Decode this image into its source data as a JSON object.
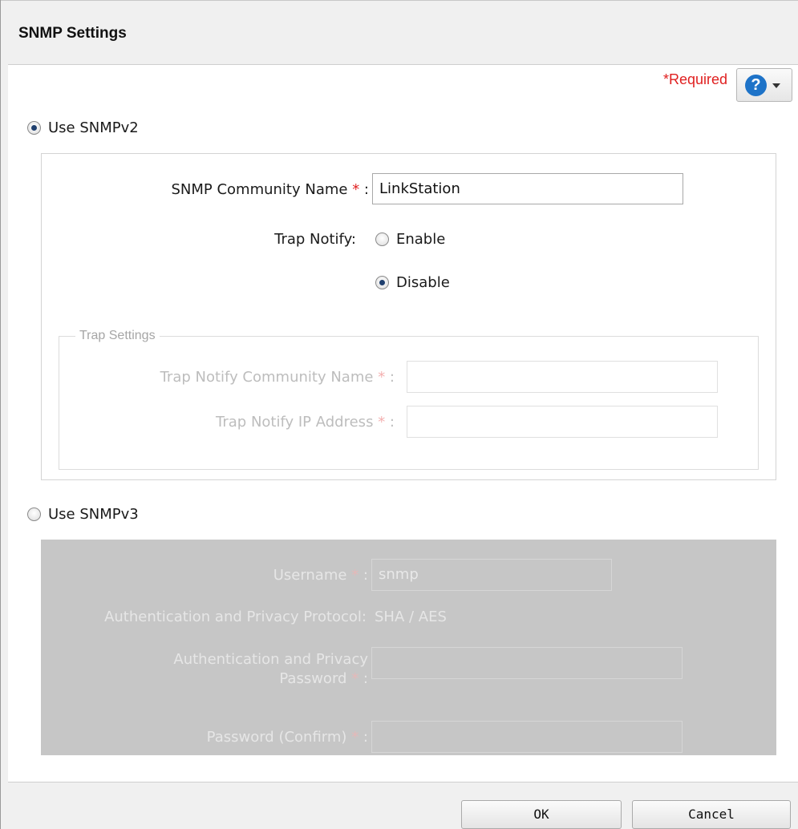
{
  "dialog": {
    "title": "SNMP Settings"
  },
  "header": {
    "required_label": "*Required",
    "help_symbol": "?"
  },
  "snmpv2": {
    "radio_label": "Use SNMPv2",
    "selected": true,
    "community_name_label": "SNMP Community Name",
    "community_name_value": "LinkStation",
    "trap_notify_label": "Trap Notify:",
    "trap_enable_label": "Enable",
    "trap_disable_label": "Disable",
    "trap_selected": "Disable",
    "trap_settings": {
      "legend": "Trap Settings",
      "community_name_label": "Trap Notify Community Name",
      "ip_address_label": "Trap Notify IP Address"
    }
  },
  "snmpv3": {
    "radio_label": "Use SNMPv3",
    "selected": false,
    "username_label": "Username",
    "username_value": "snmp",
    "protocol_label": "Authentication and Privacy Protocol:",
    "protocol_value": "SHA / AES",
    "password_label_line1": "Authentication and Privacy",
    "password_label_line2": "Password",
    "password_confirm_label": "Password (Confirm)"
  },
  "required_mark": "*",
  "colon": ":",
  "footer": {
    "ok_label": "OK",
    "cancel_label": "Cancel"
  }
}
